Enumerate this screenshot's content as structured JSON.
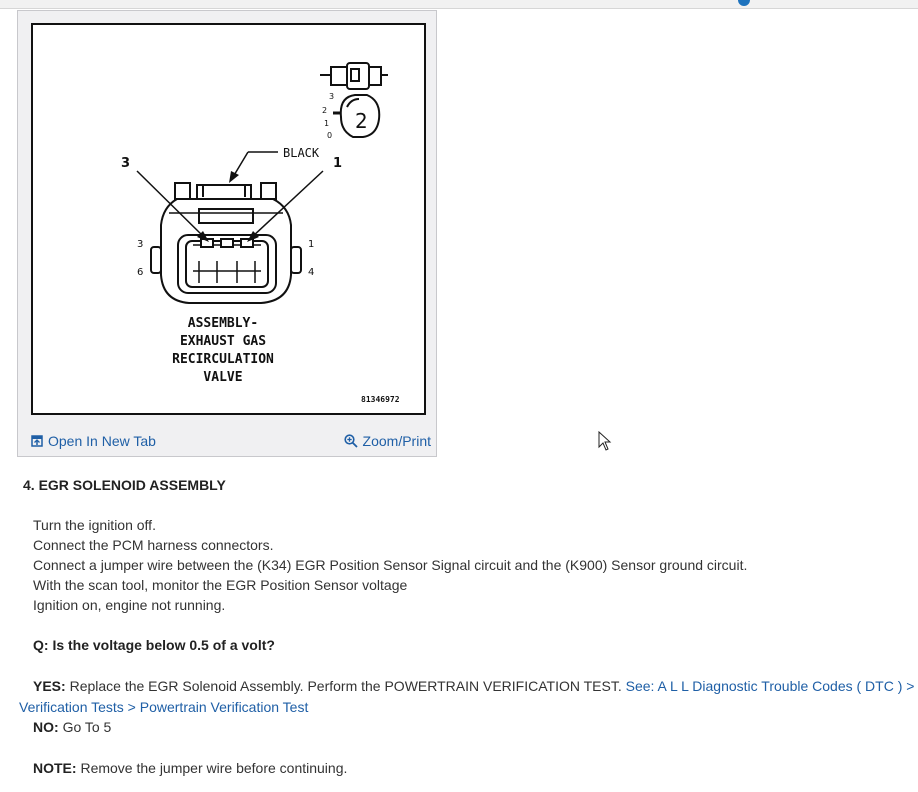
{
  "figure": {
    "connector_label": "BLACK",
    "pin_callout_left": "3",
    "pin_callout_right": "1",
    "pin_left_top": "3",
    "pin_left_bottom": "6",
    "pin_right_top": "1",
    "pin_right_bottom": "4",
    "position_number": "2",
    "position_marks": [
      "3",
      "2",
      "1",
      "0"
    ],
    "caption_lines": [
      "ASSEMBLY-",
      "EXHAUST GAS",
      "RECIRCULATION",
      "VALVE"
    ],
    "figure_id": "81346972",
    "open_tab_label": "Open In New Tab",
    "zoom_label": "Zoom/Print"
  },
  "procedure": {
    "step_title": "4. EGR SOLENOID ASSEMBLY",
    "steps": [
      "Turn the ignition off.",
      "Connect the PCM harness connectors.",
      "Connect a jumper wire between the (K34) EGR Position Sensor Signal circuit and the (K900) Sensor ground circuit.",
      "With the scan tool, monitor the EGR Position Sensor voltage",
      "Ignition on, engine not running."
    ],
    "question": "Q: Is the voltage below 0.5 of a volt?",
    "yes_label": "YES:",
    "yes_text": "Replace the EGR Solenoid Assembly. Perform the POWERTRAIN VERIFICATION TEST.",
    "yes_link_line1": "See: A L L Diagnostic Trouble Codes ( DTC ) >",
    "yes_link_line2": "Verification Tests > Powertrain Verification Test",
    "no_label": "NO:",
    "no_text": "Go To 5",
    "note_label": "NOTE:",
    "note_text": "Remove the jumper wire before continuing."
  },
  "colors": {
    "link": "#1f5fa6",
    "text": "#333333",
    "card_bg": "#f0f0f2"
  }
}
